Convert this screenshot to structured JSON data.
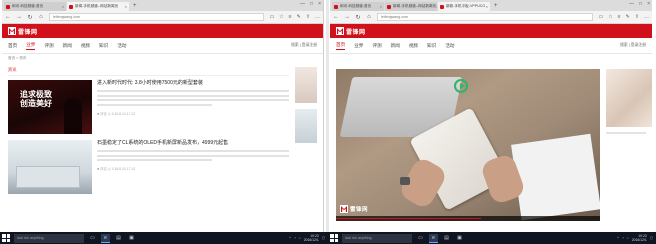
{
  "left_browser": {
    "tabs": [
      {
        "label": "和讯-科技频道-首页",
        "active": false
      },
      {
        "label": "新闻-手机频道--网站新闻页",
        "active": true
      }
    ],
    "url": "leifengwang.com",
    "site": {
      "logo_text": "雷锋网",
      "nav": [
        "首页",
        "业界",
        "评测",
        "新闻",
        "视频",
        "知识",
        "活动"
      ],
      "nav_active_index": 1,
      "nav_right": "搜索 | 登录注册",
      "breadcrumb": "首页 > 资讯",
      "section_title": "资讯",
      "articles": [
        {
          "title": "进入新时代时代: 3.8小时使用7500元的新型套装",
          "meta": "■ 评论  ◎ 3.16.8.10.17.12"
        },
        {
          "title": "石墨稳定了CL系统的OLED手机新屏新品发布，4999元起售",
          "meta": "■ 评论  ◎ 3.16.8.10.17.12"
        }
      ],
      "thumb_art_text": "追求极致\n创造美好"
    }
  },
  "right_browser": {
    "tabs": [
      {
        "label": "和讯-科技频道-首页",
        "active": false
      },
      {
        "label": "新闻-手机频道--网站新闻页",
        "active": false
      },
      {
        "label": "新款-手机平板-VPPUCO",
        "active": true
      }
    ],
    "url": "leifengwang.com",
    "site": {
      "logo_text": "雷锋网",
      "nav": [
        "首页",
        "业界",
        "评测",
        "新闻",
        "视频",
        "知识",
        "活动"
      ],
      "nav_active_index": 0,
      "nav_right": "搜索 | 登录注册"
    },
    "video": {
      "logo_text": "雷锋网",
      "progress": 0.55
    }
  },
  "taskbar": {
    "search_placeholder": "Ask me anything",
    "time": "10:23",
    "date": "2016/12/1",
    "time_right": "10:23",
    "date_right": "2016/12/1"
  },
  "colors": {
    "brand": "#d0111b",
    "taskbar": "#101522"
  }
}
